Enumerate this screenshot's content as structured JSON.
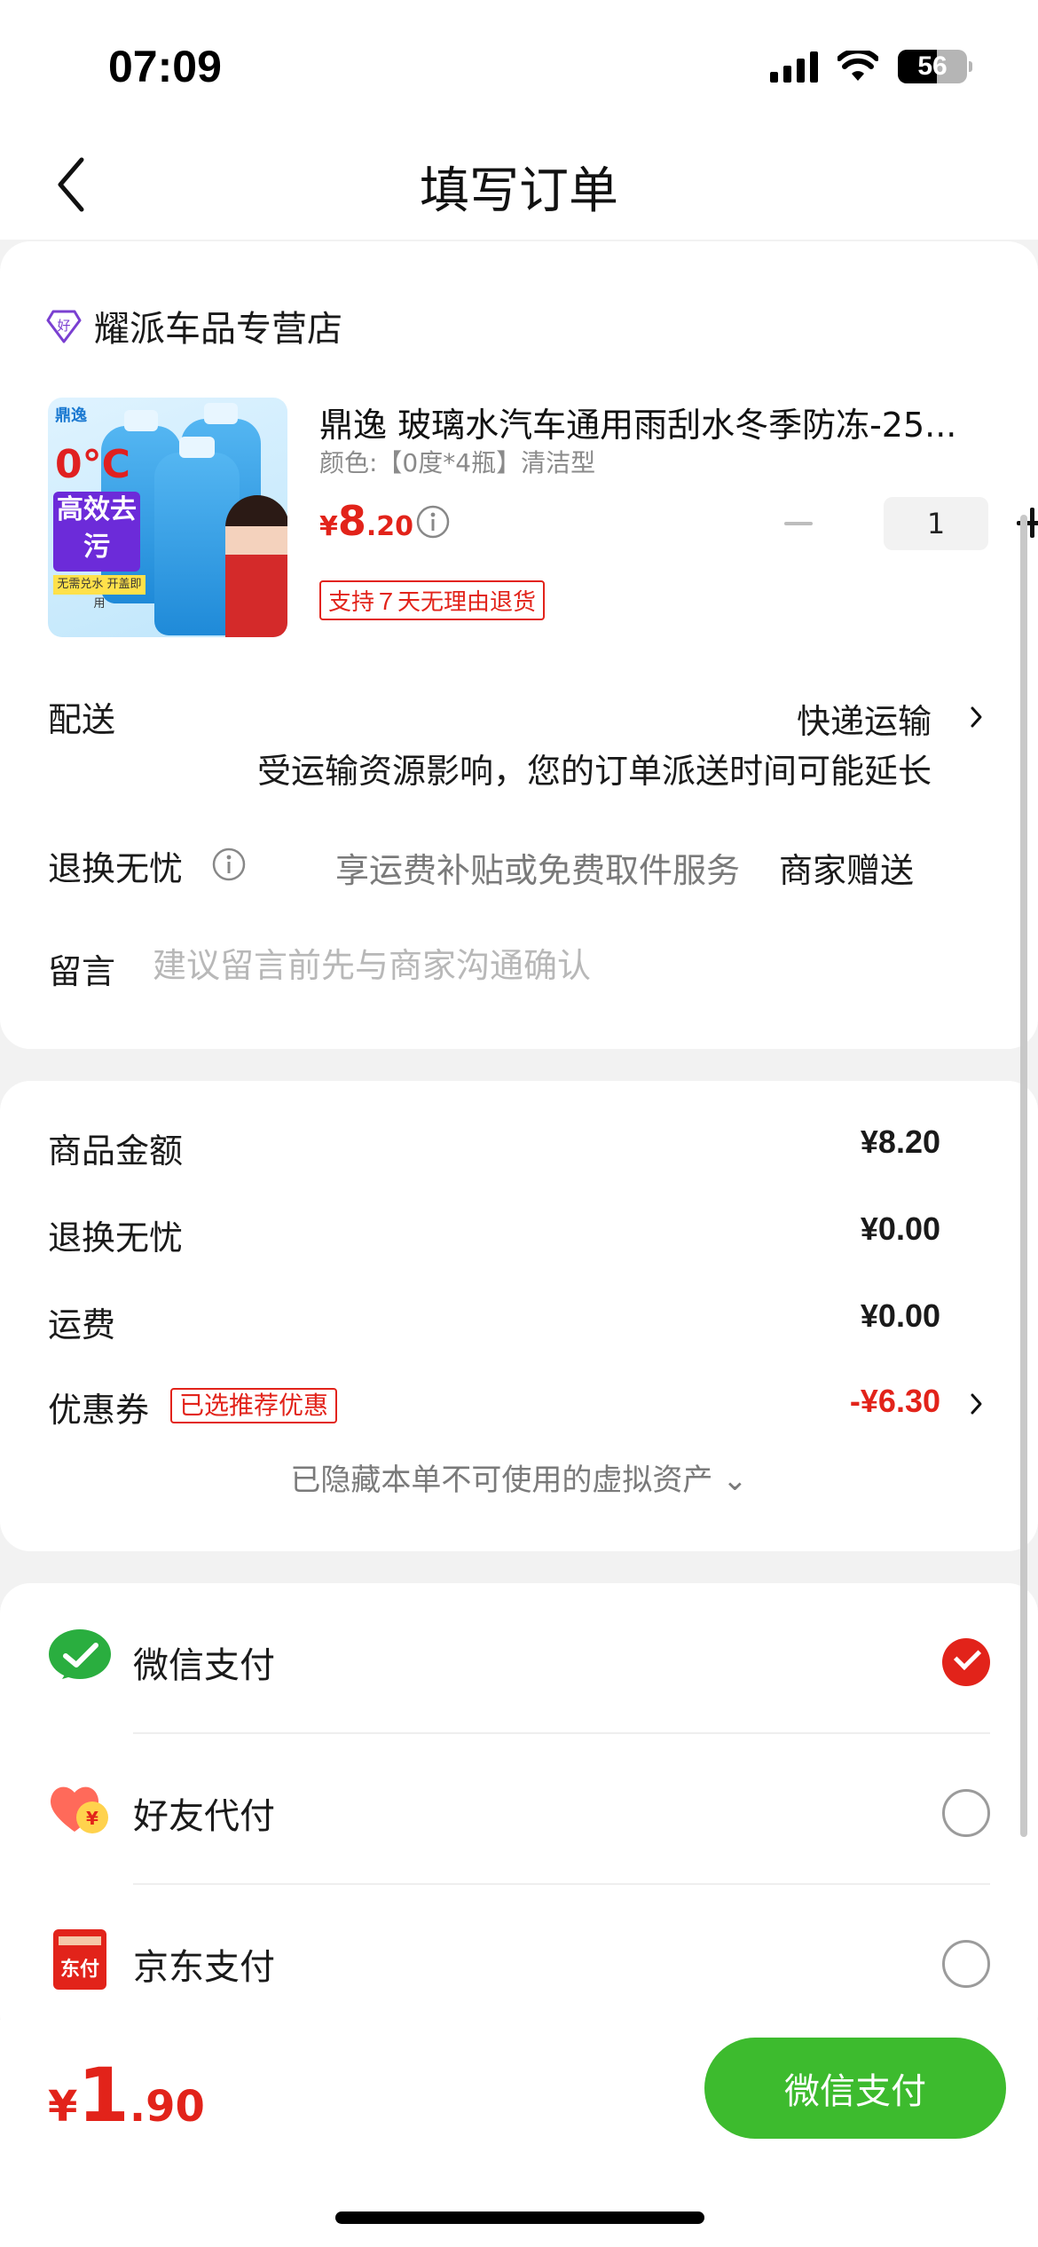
{
  "status_bar": {
    "time": "07:09",
    "battery": "56"
  },
  "nav": {
    "title": "填写订单"
  },
  "shop": {
    "name": "耀派车品专营店",
    "logo_glyph": "好"
  },
  "product": {
    "title": "鼎逸 玻璃水汽车通用雨刮水冬季防冻-25...",
    "spec": "颜色:【0度*4瓶】清洁型",
    "price_symbol": "¥",
    "price_int": "8",
    "price_dec": ".20",
    "quantity": "1",
    "return_tag": "支持７天无理由退货",
    "image": {
      "brand": "鼎逸",
      "temp": "0°C",
      "badge": "高效去污",
      "strip": "无需兑水 开盖即用"
    }
  },
  "delivery": {
    "label": "配送",
    "value": "快递运输",
    "note": "受运输资源影响，您的订单派送时间可能延长"
  },
  "worry_free": {
    "label": "退换无忧",
    "note": "享运费补贴或免费取件服务",
    "value": "商家赠送"
  },
  "message": {
    "label": "留言",
    "placeholder": "建议留言前先与商家沟通确认"
  },
  "summary": {
    "items": [
      {
        "label": "商品金额",
        "value": "¥8.20"
      },
      {
        "label": "退换无忧",
        "value": "¥0.00"
      },
      {
        "label": "运费",
        "value": "¥0.00"
      }
    ],
    "coupon": {
      "label": "优惠券",
      "tag": "已选推荐优惠",
      "value": "-¥6.30"
    },
    "hidden_assets": "已隐藏本单不可使用的虚拟资产 ⌄"
  },
  "payment_methods": [
    {
      "label": "微信支付",
      "icon": "wechat-pay-icon",
      "selected": true
    },
    {
      "label": "好友代付",
      "icon": "friend-pay-icon",
      "selected": false
    },
    {
      "label": "京东支付",
      "icon": "jd-pay-icon",
      "icon_text": "东付",
      "selected": false
    }
  ],
  "footer": {
    "total_symbol": "¥",
    "total_int": "1",
    "total_dec": ".90",
    "pay_button": "微信支付"
  },
  "colors": {
    "accent_red": "#e2231a",
    "wechat_green": "#3dbb2e"
  }
}
